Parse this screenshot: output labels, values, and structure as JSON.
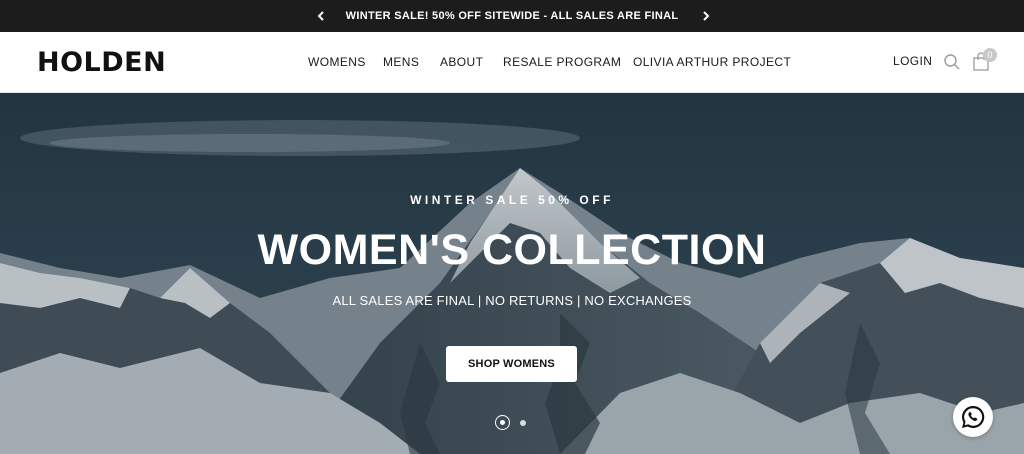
{
  "announcement": {
    "message": "WINTER SALE! 50% OFF SITEWIDE - ALL SALES ARE FINAL",
    "prev_icon": "chevron-left-icon",
    "next_icon": "chevron-right-icon"
  },
  "header": {
    "logo": "HOLDEN",
    "nav": [
      "WOMENS",
      "MENS",
      "ABOUT",
      "RESALE PROGRAM",
      "OLIVIA ARTHUR PROJECT"
    ],
    "login_label": "LOGIN",
    "cart_count": "0",
    "search_icon": "search-icon",
    "cart_icon": "shopping-bag-icon"
  },
  "hero": {
    "eyebrow": "WINTER SALE 50% OFF",
    "title": "WOMEN'S COLLECTION",
    "subtitle": "ALL SALES ARE FINAL | NO RETURNS | NO EXCHANGES",
    "cta_label": "SHOP WOMENS",
    "slides_total": 2,
    "active_slide": 1
  },
  "chat": {
    "icon": "whatsapp-icon"
  },
  "colors": {
    "announcement_bg": "#1c1c1c",
    "header_bg": "#ffffff",
    "text": "#111111",
    "hero_sky": "#2e4452"
  }
}
